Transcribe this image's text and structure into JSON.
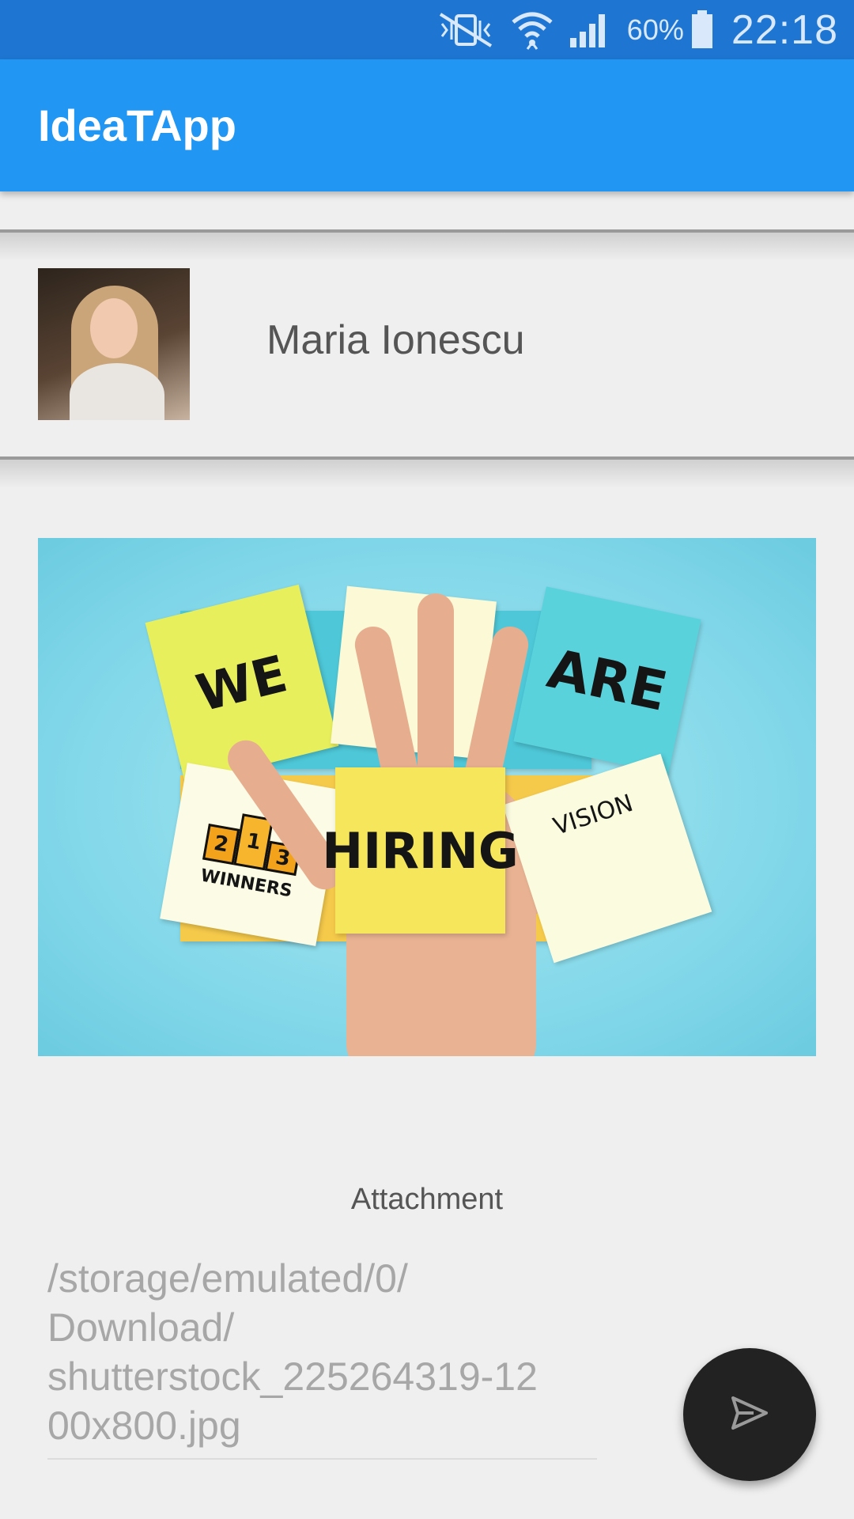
{
  "status_bar": {
    "battery_percent": "60%",
    "time": "22:18",
    "icons": [
      "vibrate-mute-icon",
      "wifi-icon",
      "signal-icon",
      "battery-icon"
    ]
  },
  "app_bar": {
    "title": "IdeaTApp"
  },
  "profile": {
    "name": "Maria Ionescu",
    "avatar_icon": "avatar"
  },
  "post_image": {
    "notes": [
      "WE",
      "ARE",
      "HIRING",
      "VISION",
      "WINNERS",
      "1",
      "2",
      "3"
    ]
  },
  "attachment": {
    "label": "Attachment",
    "path": "/storage/emulated/0/\nDownload/\nshutterstock_225264319-12\n00x800.jpg"
  },
  "fab": {
    "icon": "send-icon"
  },
  "colors": {
    "status_bar": "#1e76d2",
    "app_bar": "#2196f3",
    "fab": "#222222",
    "background": "#efefef"
  }
}
